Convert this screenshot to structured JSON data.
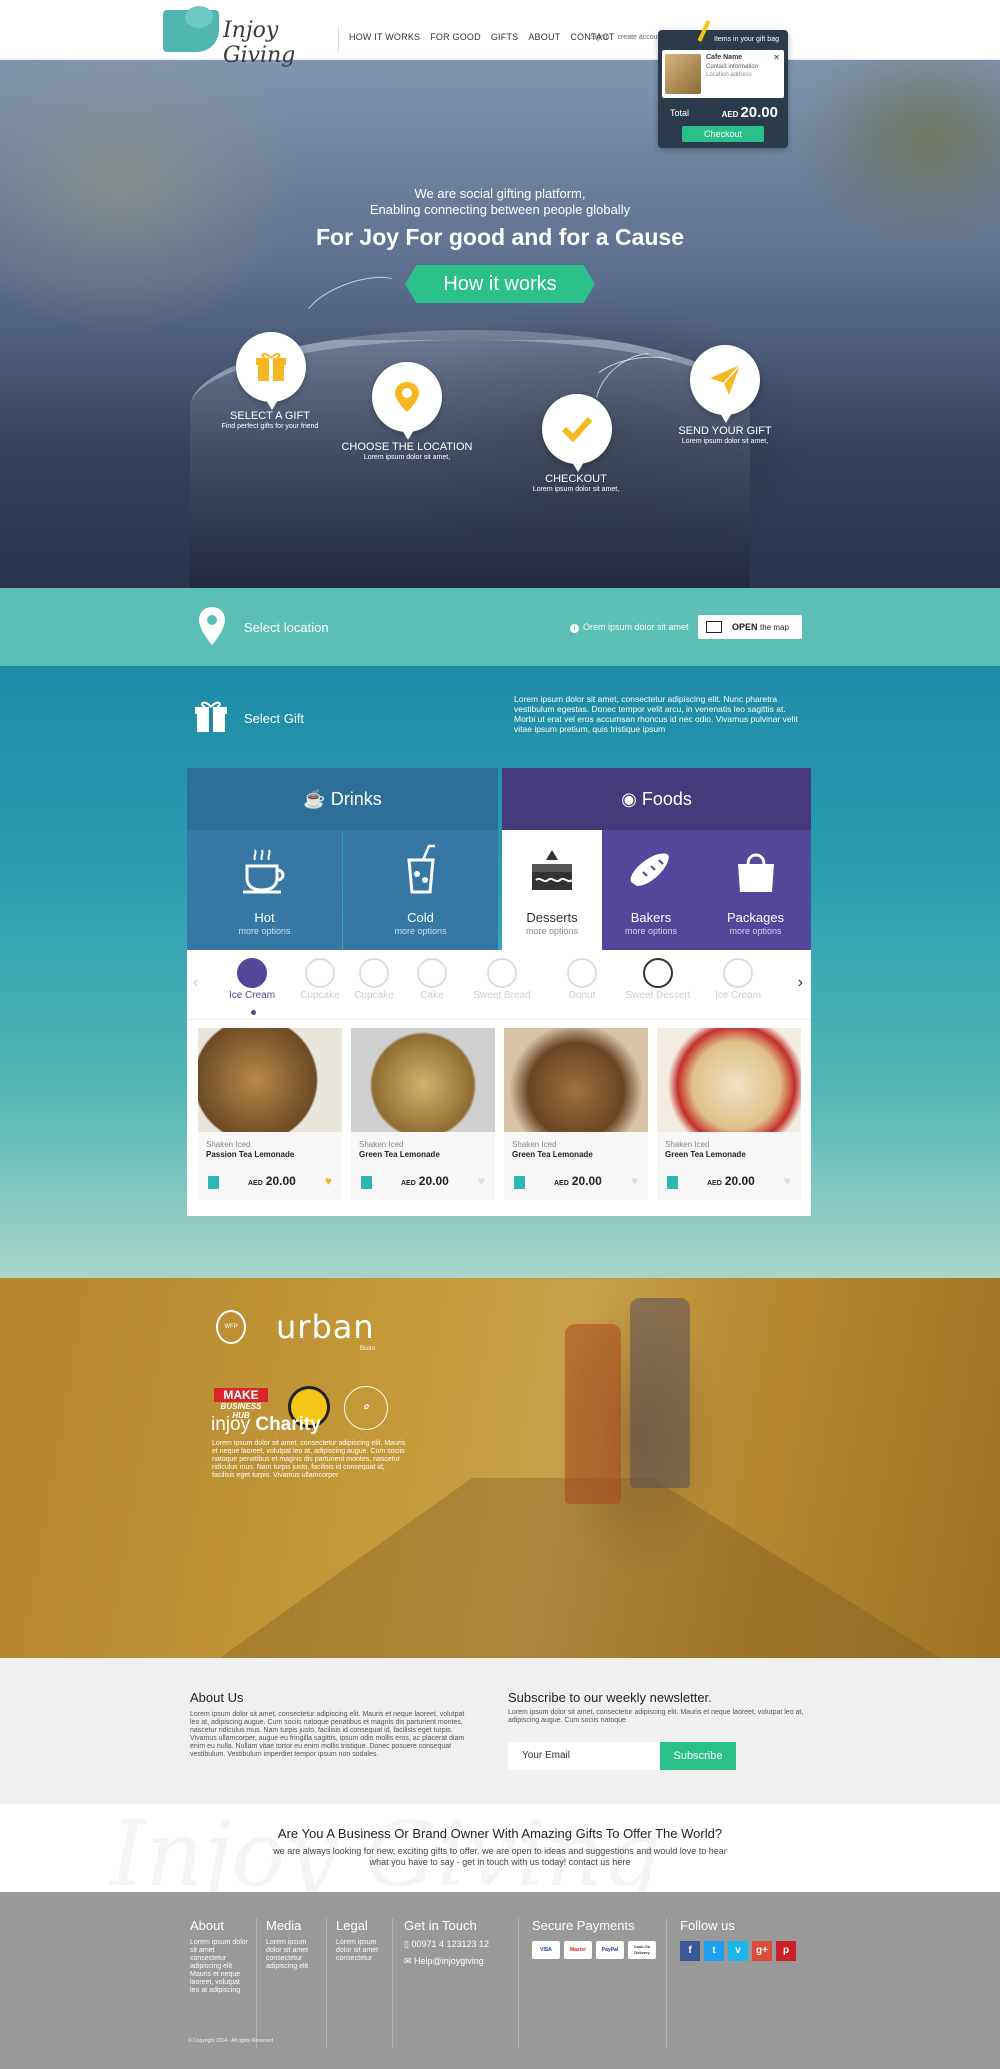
{
  "header": {
    "logo": "Injoy Giving",
    "nav": [
      "HOW IT WORKS",
      "FOR GOOD",
      "GIFTS",
      "ABOUT",
      "CONTACT"
    ],
    "signin": "Signin",
    "create_account": "create account"
  },
  "gift_bag": {
    "title": "Items in your gift bag",
    "item_name": "Cafe Name",
    "item_info": "Contact information",
    "item_address": "Location address",
    "total_label": "Total",
    "currency": "AED",
    "total_value": "20.00",
    "checkout": "Checkout"
  },
  "hero": {
    "subtitle_1": "We are social gifting platform,",
    "subtitle_2": "Enabling connecting between people globally",
    "title": "For Joy  For good and for a Cause",
    "cta": "How it works",
    "steps": [
      {
        "label": "SELECT A GIFT",
        "desc": "Find perfect gifts for your friend"
      },
      {
        "label": "CHOOSE THE LOCATION",
        "desc": "Lorem ipsum dolor sit amet,"
      },
      {
        "label": "CHECKOUT",
        "desc": "Lorem ipsum dolor sit amet,"
      },
      {
        "label": "SEND YOUR GIFT",
        "desc": "Lorem ipsum dolor sit amet,"
      }
    ]
  },
  "location": {
    "label": "Select location",
    "info": "Orem ipsum dolor sit amet",
    "map_button_bold": "OPEN",
    "map_button_rest": "the map"
  },
  "gift": {
    "label": "Select Gift",
    "text": "Lorem ipsum dolor sit amet, consectetur adipiscing elit. Nunc pharetra vestibulum egestas. Donec tempor velit arcu, in venenatis leo sagittis at. Morbi ut erat vel eros accumsan rhoncus id nec odio. Vivamus pulvinar velit vitae ipsum pretium, quis tristique ipsum",
    "drinks": "Drinks",
    "foods": "Foods",
    "subcategories": [
      {
        "name": "Hot",
        "more": "more options"
      },
      {
        "name": "Cold",
        "more": "more options"
      },
      {
        "name": "Desserts",
        "more": "more options"
      },
      {
        "name": "Bakers",
        "more": "more options"
      },
      {
        "name": "Packages",
        "more": "more options"
      }
    ],
    "strip": [
      "Ice Cream",
      "Cupcake",
      "Cupcake",
      "Cake",
      "Sweet Bread",
      "Donut",
      "Sweet Dessert",
      "Ice Cream"
    ],
    "products": [
      {
        "sub": "Shaken Iced",
        "name": "Passion Tea Lemonade",
        "currency": "AED",
        "price": "20.00"
      },
      {
        "sub": "Shaken Iced",
        "name": "Green Tea Lemonade",
        "currency": "AED",
        "price": "20.00"
      },
      {
        "sub": "Shaken Iced",
        "name": "Green Tea Lemonade",
        "currency": "AED",
        "price": "20.00"
      },
      {
        "sub": "Shaken Iced",
        "name": "Green Tea Lemonade",
        "currency": "AED",
        "price": "20.00"
      }
    ]
  },
  "charity": {
    "partners": {
      "wfp": "WFP",
      "urban": "urban",
      "urban_sub": "Bistro",
      "make": "MAKE",
      "business_hub": "BUSINESS HUB"
    },
    "title_light": "injoy",
    "title_bold": "Charity",
    "text": "Lorem ipsum dolor sit amet, consectetur adipiscing elit. Mauris et neque laoreet, volutpat leo at, adipiscing augue. Cum sociis natoque penatibus et magnis dis parturient montes, nascetur ridiculus mus. Nam turpis justo, facilisis id consequat id, facilisis eget turpis. Vivamus ullamcorper"
  },
  "about": {
    "title": "About Us",
    "text": "Lorem ipsum dolor sit amet, consectetur adipiscing elit. Mauris et neque laoreet, volutpat leo at, adipiscing augue. Cum sociis natoque penatibus et magnis dis parturient montes, nascetur ridiculus mus. Nam turpis justo, facilisis id consequat id, facilisis eget turpis. Vivamus ullamcorper, augue eu fringilla sagittis, ipsum odio mollis eros, ac placerat diam enim eu nulla. Nullam vitae tortor eu enim mollis tristique. Donec posuere consequat vestibulum. Vestibulum imperdiet tempor ipsum non sodales."
  },
  "newsletter": {
    "title": "Subscribe to our weekly newsletter.",
    "text": "Lorem ipsum dolor sit amet, consectetur adipiscing elit. Mauris et neque laoreet, volutpat leo at, adipiscing augue. Cum sociis natoque",
    "placeholder": "Your Email",
    "button": "Subscribe"
  },
  "business": {
    "watermark": "Injoy Giving",
    "title": "Are You A Business Or Brand Owner With Amazing Gifts To Offer The World?",
    "text": "we are always looking for new, exciting gifts to offer. we are open to ideas and suggestions and would love to hear what you have to say - get in touch with us today! contact us here"
  },
  "footer": {
    "about": {
      "title": "About",
      "text": "Lorem ipsum dolor sit amet consectetur adipiscing elit Mauris et neque laoreet, volutpat leo at adipiscing"
    },
    "media": {
      "title": "Media",
      "text": "Lorem ipsum dolor sit amet consectetur adipiscing elit"
    },
    "legal": {
      "title": "Legal",
      "text": "Lorem ipsum dolor sit amet consectetur"
    },
    "contact": {
      "title": "Get in Touch",
      "phone": "00971 4 123123 12",
      "email": "Help@injoygiving"
    },
    "payments": {
      "title": "Secure Payments",
      "methods": [
        "VISA",
        "Master",
        "PayPal",
        "Cash On Delivery"
      ]
    },
    "follow": {
      "title": "Follow us",
      "networks": [
        "f",
        "t",
        "v",
        "g+",
        "p"
      ]
    },
    "copyright": "© Copyright 2014 - All rights Reserved"
  },
  "colors": {
    "green": "#2bbf8a",
    "teal": "#5bbfb6",
    "drinks_blue": "#2e6f98",
    "foods_purple": "#463a7a",
    "charity_gold": "#c49a3a",
    "footer_gray": "#999999"
  }
}
